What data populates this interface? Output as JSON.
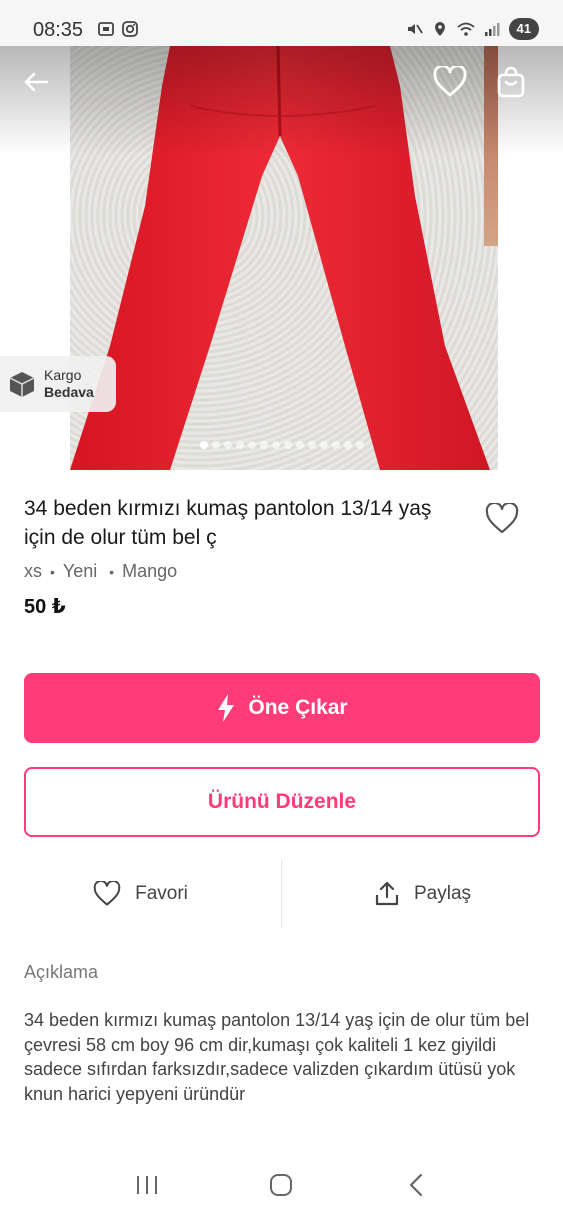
{
  "status_bar": {
    "time": "08:35",
    "battery": "41"
  },
  "image": {
    "cargo_badge_line1": "Kargo",
    "cargo_badge_line2": "Bedava",
    "dots_total": 14,
    "dots_active_index": 0
  },
  "product": {
    "title": "34 beden kırmızı kumaş pantolon 13/14 yaş için de olur tüm bel ç",
    "size": "xs",
    "condition": "Yeni",
    "brand": "Mango",
    "price": "50 ₺"
  },
  "buttons": {
    "promote_label": "Öne Çıkar",
    "edit_label": "Ürünü Düzenle"
  },
  "actions": {
    "favorite_label": "Favori",
    "share_label": "Paylaş"
  },
  "description": {
    "label": "Açıklama",
    "text": "34 beden kırmızı kumaş pantolon 13/14 yaş için de olur tüm bel çevresi 58 cm boy 96 cm dir,kumaşı çok kaliteli 1 kez giyildi sadece sıfırdan farksızdır,sadece valizden çıkardım ütüsü yok knun harici yepyeni üründür"
  },
  "colors": {
    "accent": "#ff3b79",
    "pants": "#e21d2a"
  },
  "icons": {
    "back": "arrow-left-icon",
    "favorite": "heart-icon",
    "bag": "shopping-bag-icon",
    "cargo": "box-icon",
    "promote": "lightning-icon",
    "share": "share-icon"
  }
}
